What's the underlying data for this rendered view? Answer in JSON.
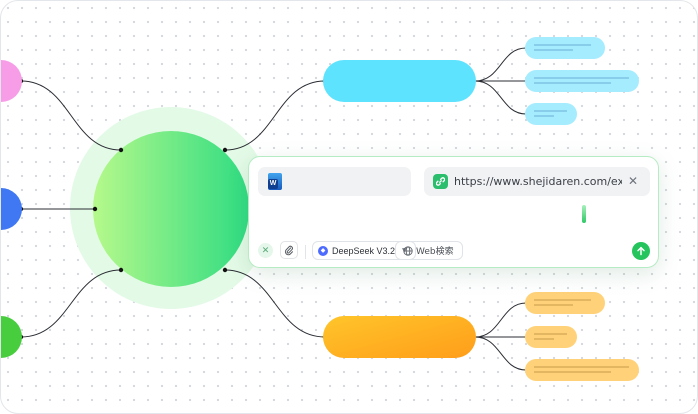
{
  "colors": {
    "center_start": "#b6f98b",
    "center_end": "#2fdc82",
    "halo": "#e3fae7",
    "pink": "#f79ce6",
    "blue": "#3f78f2",
    "green": "#48cd3f",
    "cyan_node": "#5ee3ff",
    "cyan_leaf": "#a6ecff",
    "orange_start": "#ffc52a",
    "orange_end": "#ff9d1a",
    "orange_leaf": "#ffd27a",
    "accent": "#25c45c"
  },
  "panel": {
    "doc_icon": "word-doc-icon",
    "url": "https://www.shejidaren.com/exam···",
    "url_close": "✕",
    "clear_label": "✕",
    "model": "DeepSeek V3.2",
    "web_search": "Web検索",
    "send_icon": "arrow-up-icon"
  }
}
